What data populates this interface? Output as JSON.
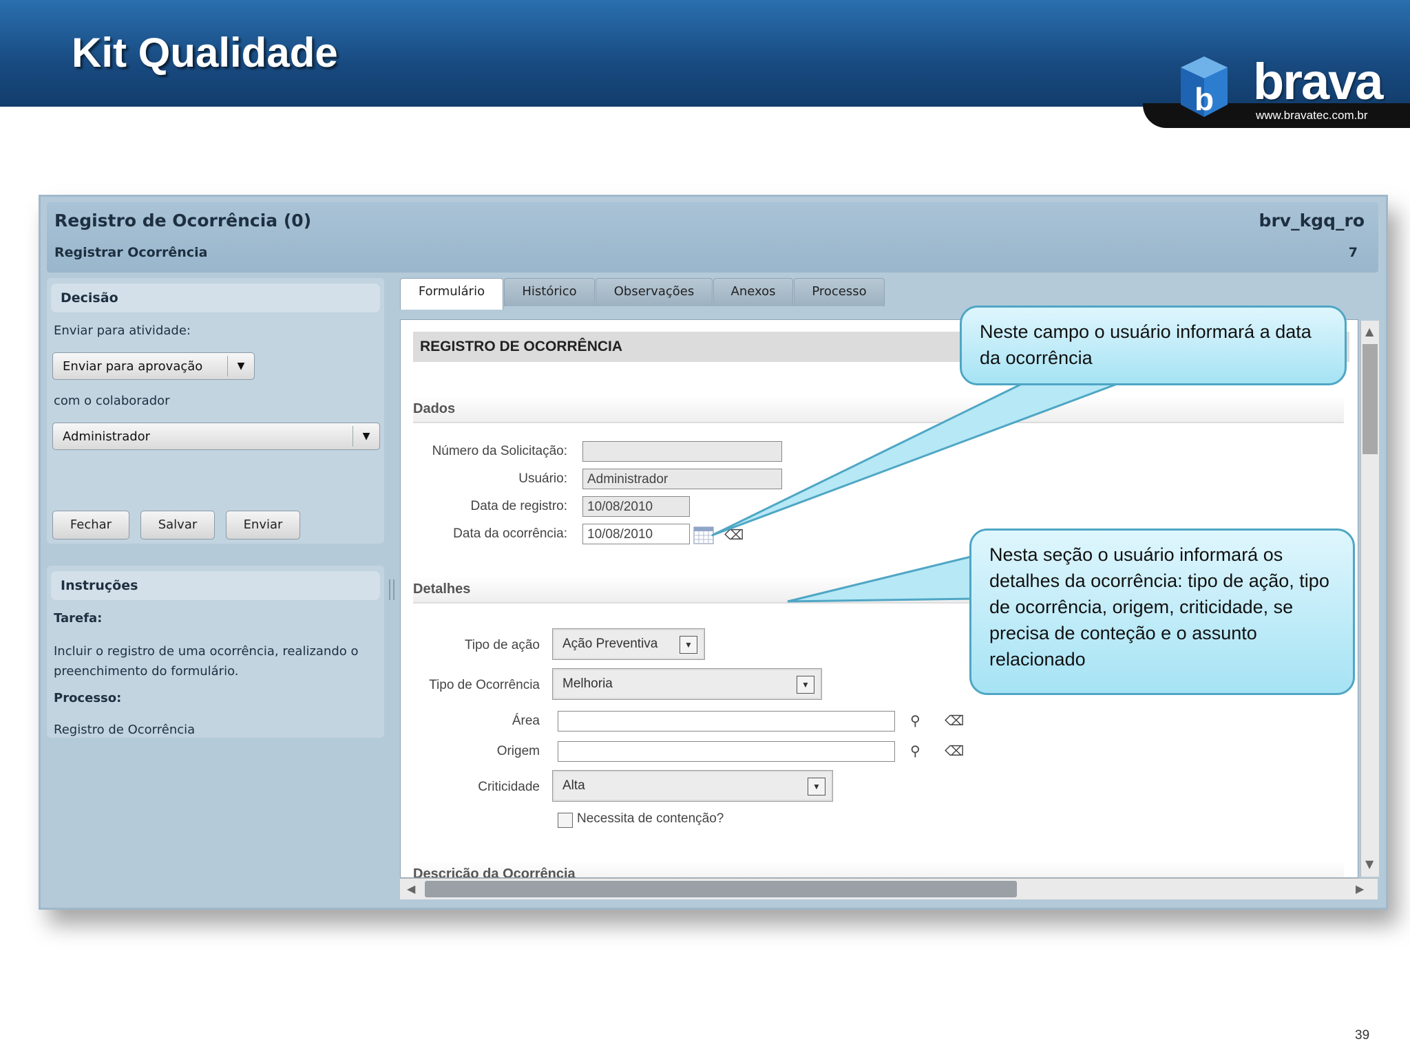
{
  "slide": {
    "title": "Kit Qualidade",
    "logo_text": "brava",
    "logo_url": "www.bravatec.com.br",
    "page_number": "39"
  },
  "app": {
    "title": "Registro de Ocorrência (0)",
    "code": "brv_kgq_ro",
    "subtitle": "Registrar Ocorrência",
    "count": "7"
  },
  "decision": {
    "heading": "Decisão",
    "send_label": "Enviar para atividade:",
    "activity_value": "Enviar para aprovação",
    "with_label": "com o colaborador",
    "collaborator_value": "Administrador",
    "buttons": [
      "Fechar",
      "Salvar",
      "Enviar"
    ]
  },
  "instructions": {
    "heading": "Instruções",
    "task_label": "Tarefa:",
    "task_text": "Incluir o registro de uma ocorrência, realizando o preenchimento do formulário.",
    "process_label": "Processo:",
    "process_text": "Registro de Ocorrência"
  },
  "tabs": [
    "Formulário",
    "Histórico",
    "Observações",
    "Anexos",
    "Processo"
  ],
  "form": {
    "title": "REGISTRO DE OCORRÊNCIA",
    "section_dados": "Dados",
    "numero_label": "Número da Solicitação:",
    "numero_value": "",
    "usuario_label": "Usuário:",
    "usuario_value": "Administrador",
    "data_registro_label": "Data de registro:",
    "data_registro_value": "10/08/2010",
    "data_ocorrencia_label": "Data da ocorrência:",
    "data_ocorrencia_value": "10/08/2010",
    "section_detalhes": "Detalhes",
    "tipo_acao_label": "Tipo de ação",
    "tipo_acao_value": "Ação Preventiva",
    "tipo_ocorrencia_label": "Tipo de Ocorrência",
    "tipo_ocorrencia_value": "Melhoria",
    "area_label": "Área",
    "area_value": "",
    "origem_label": "Origem",
    "origem_value": "",
    "criticidade_label": "Criticidade",
    "criticidade_value": "Alta",
    "contencao_label": "Necessita de contenção?",
    "section_descricao": "Descrição da Ocorrência"
  },
  "callouts": {
    "date": "Neste campo o usuário informará  a data da ocorrência",
    "details": "Nesta seção o usuário informará os detalhes da ocorrência: tipo de ação, tipo de ocorrência, origem, criticidade, se precisa de conteção e o assunto relacionado"
  },
  "colors": {
    "header_blue": "#184a80",
    "panel_blue": "#b4cad9",
    "callout_cyan": "#a6e3f4"
  }
}
